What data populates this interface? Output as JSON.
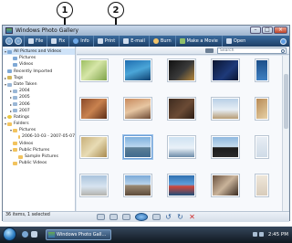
{
  "callouts": [
    "1",
    "2"
  ],
  "window": {
    "title": "Windows Photo Gallery"
  },
  "toolbar": {
    "file": "File",
    "fix": "Fix",
    "info": "Info",
    "print": "Print",
    "email": "E-mail",
    "burn": "Burn",
    "make_movie": "Make a Movie",
    "open": "Open"
  },
  "sidebar": {
    "items": [
      "All Pictures and Videos",
      "Pictures",
      "Videos",
      "Recently Imported",
      "Tags",
      "Date Taken",
      "2004",
      "2005",
      "2006",
      "2007",
      "Ratings",
      "Folders",
      "Pictures",
      "2006-10-03 - 2007-05-07",
      "Videos",
      "Public Pictures",
      "Sample Pictures",
      "Public Videos"
    ]
  },
  "search": {
    "placeholder": "Search"
  },
  "status": {
    "text": "36 items, 1 selected"
  },
  "taskbar": {
    "task_label": "Windows Photo Gall...",
    "clock": "2:45 PM"
  }
}
